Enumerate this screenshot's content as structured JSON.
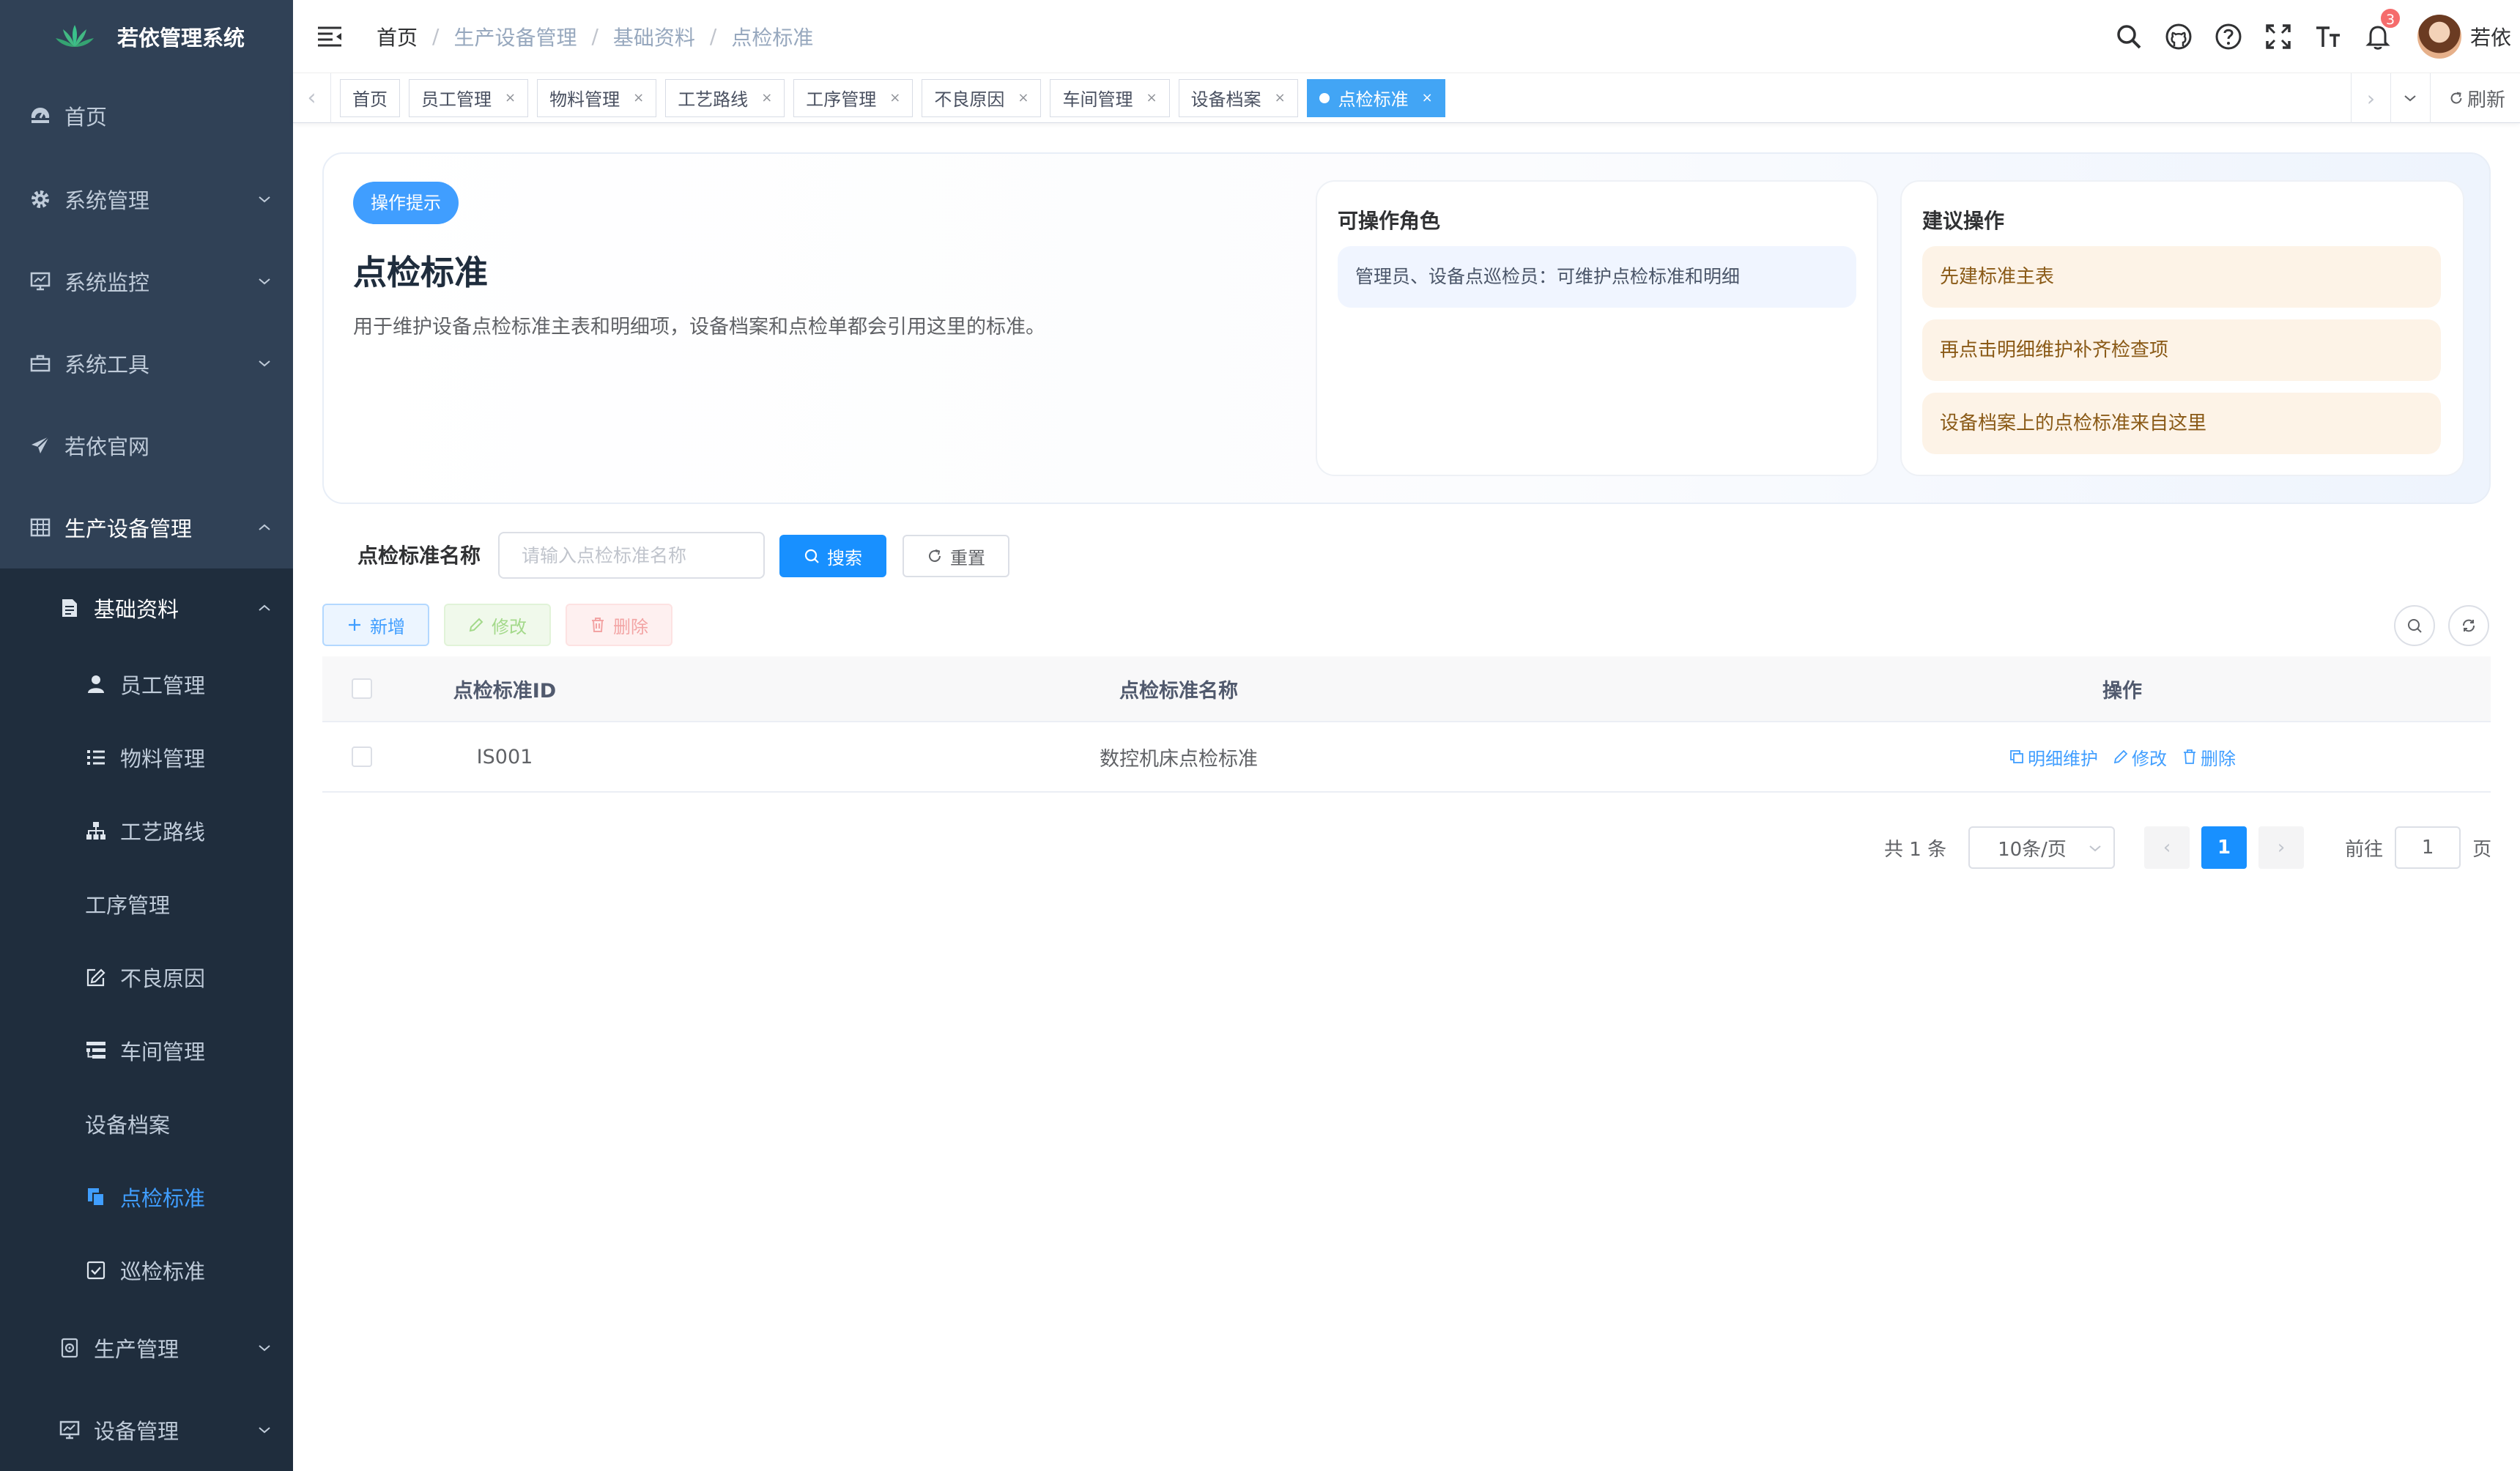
{
  "app": {
    "title": "若依管理系统"
  },
  "sidebar": {
    "items": [
      {
        "label": "首页",
        "icon": "dashboard-icon"
      },
      {
        "label": "系统管理",
        "icon": "gear-icon"
      },
      {
        "label": "系统监控",
        "icon": "monitor-icon"
      },
      {
        "label": "系统工具",
        "icon": "toolbox-icon"
      },
      {
        "label": "若依官网",
        "icon": "paper-plane-icon"
      },
      {
        "label": "生产设备管理",
        "icon": "table-icon"
      }
    ],
    "submenu": {
      "label": "基础资料",
      "icon": "document-icon"
    },
    "leaves": [
      {
        "label": "员工管理",
        "icon": "user-icon"
      },
      {
        "label": "物料管理",
        "icon": "list-icon"
      },
      {
        "label": "工艺路线",
        "icon": "tree-icon"
      },
      {
        "label": "工序管理",
        "icon": ""
      },
      {
        "label": "不良原因",
        "icon": "edit-icon"
      },
      {
        "label": "车间管理",
        "icon": "tree-table-icon"
      },
      {
        "label": "设备档案",
        "icon": ""
      },
      {
        "label": "点检标准",
        "icon": "copy-icon"
      },
      {
        "label": "巡检标准",
        "icon": "checkbox-icon"
      }
    ],
    "after": [
      {
        "label": "生产管理",
        "icon": "production-icon"
      },
      {
        "label": "设备管理",
        "icon": "monitor-icon"
      }
    ],
    "active_color": "#409eff",
    "bg_color": "#304156"
  },
  "header": {
    "breadcrumb": [
      "首页",
      "生产设备管理",
      "基础资料",
      "点检标准"
    ],
    "notification_count": "3",
    "username": "若依"
  },
  "tags": [
    {
      "label": "首页",
      "closable": false
    },
    {
      "label": "员工管理",
      "closable": true
    },
    {
      "label": "物料管理",
      "closable": true
    },
    {
      "label": "工艺路线",
      "closable": true
    },
    {
      "label": "工序管理",
      "closable": true
    },
    {
      "label": "不良原因",
      "closable": true
    },
    {
      "label": "车间管理",
      "closable": true
    },
    {
      "label": "设备档案",
      "closable": true
    },
    {
      "label": "点检标准",
      "closable": true,
      "active": true
    }
  ],
  "tags_refresh": "刷新",
  "info": {
    "badge": "操作提示",
    "title": "点检标准",
    "description": "用于维护设备点检标准主表和明细项，设备档案和点检单都会引用这里的标准。",
    "roles_title": "可操作角色",
    "roles_text": "管理员、设备点巡检员：可维护点检标准和明细",
    "suggest_title": "建议操作",
    "suggestions": [
      "先建标准主表",
      "再点击明细维护补齐检查项",
      "设备档案上的点检标准来自这里"
    ]
  },
  "search": {
    "label": "点检标准名称",
    "placeholder": "请输入点检标准名称",
    "value": "",
    "search_btn": "搜索",
    "reset_btn": "重置"
  },
  "toolbar": {
    "add": "新增",
    "edit": "修改",
    "delete": "删除"
  },
  "table": {
    "columns": [
      "点检标准ID",
      "点检标准名称",
      "操作"
    ],
    "rows": [
      {
        "id": "IS001",
        "name": "数控机床点检标准",
        "actions": [
          "明细维护",
          "修改",
          "删除"
        ]
      }
    ]
  },
  "pagination": {
    "total": "共 1 条",
    "page_size": "10条/页",
    "current": "1",
    "goto_prefix": "前往",
    "goto_value": "1",
    "goto_suffix": "页"
  }
}
